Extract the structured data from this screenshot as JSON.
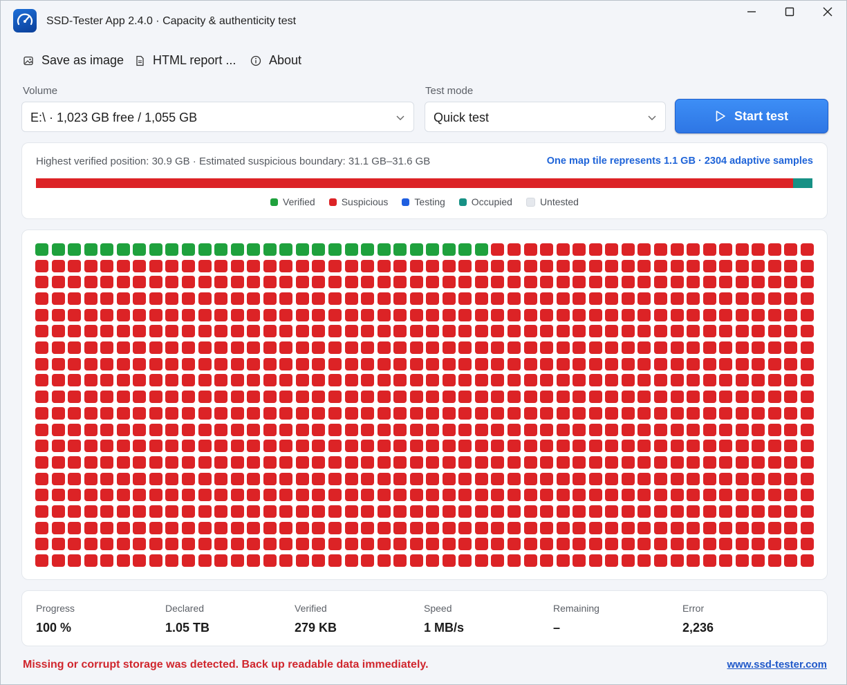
{
  "window": {
    "title": "SSD-Tester App 2.4.0 · Capacity & authenticity test",
    "controls": [
      "minimize",
      "maximize",
      "close"
    ]
  },
  "menu": [
    {
      "label": "Save as image",
      "icon": "image-icon"
    },
    {
      "label": "HTML report ...",
      "icon": "document-icon"
    },
    {
      "label": "About",
      "icon": "info-icon"
    }
  ],
  "form": {
    "volume_label": "Volume",
    "volume_value": "E:\\  ·  1,023 GB free / 1,055 GB",
    "mode_label": "Test mode",
    "mode_value": "Quick test",
    "start_label": "Start test"
  },
  "summary": {
    "text": "Highest verified position: 30.9 GB · Estimated suspicious boundary: 31.1 GB–31.6 GB",
    "tile_note": "One map tile represents 1.1 GB · 2304 adaptive samples",
    "bar": [
      {
        "state": "suspicious",
        "fraction": 0.975
      },
      {
        "state": "occupied",
        "fraction": 0.025
      }
    ]
  },
  "legend": [
    {
      "label": "Verified",
      "state": "verified"
    },
    {
      "label": "Suspicious",
      "state": "suspicious"
    },
    {
      "label": "Testing",
      "state": "testing"
    },
    {
      "label": "Occupied",
      "state": "occupied"
    },
    {
      "label": "Untested",
      "state": "untested"
    }
  ],
  "colors": {
    "verified": "#1fa13d",
    "suspicious": "#dc2326",
    "testing": "#1f5fe0",
    "occupied": "#179185",
    "untested": "#e5e8ed",
    "accent": "#2e7ae8"
  },
  "map": {
    "columns": 48,
    "rows": 20,
    "verified_tiles": 28,
    "other_state": "suspicious"
  },
  "stats": [
    {
      "label": "Progress",
      "value": "100 %"
    },
    {
      "label": "Declared",
      "value": "1.05 TB"
    },
    {
      "label": "Verified",
      "value": "279 KB"
    },
    {
      "label": "Speed",
      "value": "1 MB/s"
    },
    {
      "label": "Remaining",
      "value": "–"
    },
    {
      "label": "Error",
      "value": "2,236"
    }
  ],
  "footer": {
    "alert": "Missing or corrupt storage was detected. Back up readable data immediately.",
    "link": "www.ssd-tester.com"
  }
}
